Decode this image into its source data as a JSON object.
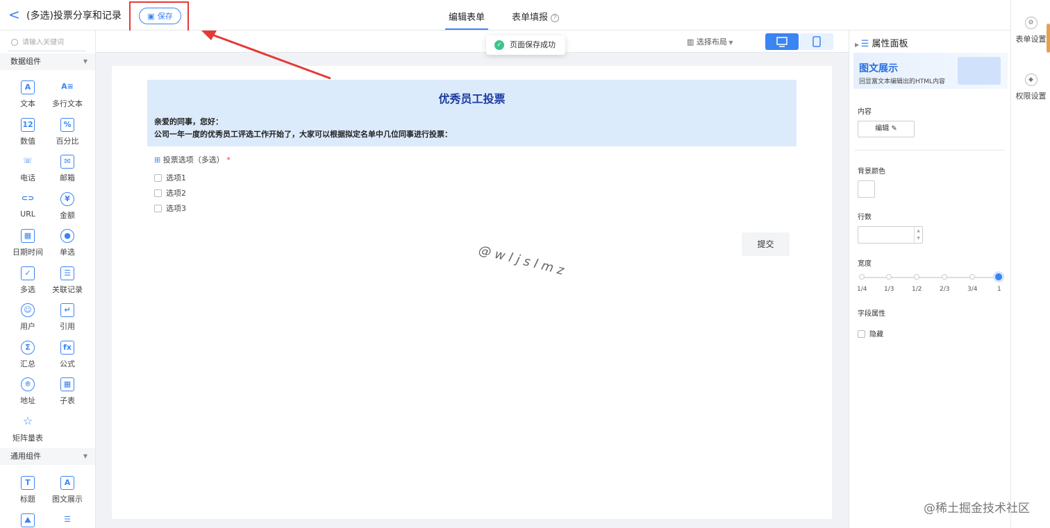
{
  "header": {
    "back": "<",
    "title": "(多选)投票分享和记录",
    "save_label": "保存",
    "tabs": [
      {
        "label": "编辑表单"
      },
      {
        "label": "表单填报"
      }
    ]
  },
  "toast": {
    "text": "页面保存成功"
  },
  "toolbar": {
    "layout_label": "选择布局"
  },
  "sidebar": {
    "search_placeholder": "请输入关键词",
    "groups": [
      {
        "label": "数据组件",
        "items": [
          "文本",
          "多行文本",
          "数值",
          "百分比",
          "电话",
          "邮箱",
          "URL",
          "金额",
          "日期时间",
          "单选",
          "多选",
          "关联记录",
          "用户",
          "引用",
          "汇总",
          "公式",
          "地址",
          "子表",
          "矩阵量表"
        ]
      },
      {
        "label": "通用组件",
        "items": [
          "标题",
          "图文展示"
        ]
      }
    ]
  },
  "form": {
    "heading": "优秀员工投票",
    "line1": "亲爱的同事，您好：",
    "line2": "公司一年一度的优秀员工评选工作开始了，大家可以根据拟定名单中几位同事进行投票：",
    "field_label": "投票选项（多选）",
    "options": [
      "选项1",
      "选项2",
      "选项3"
    ],
    "submit": "提交",
    "watermark": "@wljslmz"
  },
  "props": {
    "title": "属性面板",
    "banner_title": "图文展示",
    "banner_sub": "回显富文本编辑出的HTML内容",
    "content_label": "内容",
    "edit_label": "编辑",
    "bg_label": "背景颜色",
    "rows_label": "行数",
    "width_label": "宽度",
    "width_ticks": [
      "1/4",
      "1/3",
      "1/2",
      "2/3",
      "3/4",
      "1"
    ],
    "width_selected": "1",
    "field_attr_label": "字段属性",
    "hide_label": "隐藏"
  },
  "rail": {
    "items": [
      {
        "label": "表单设置"
      },
      {
        "label": "权限设置"
      }
    ]
  },
  "brand": "@稀土掘金技术社区",
  "colors": {
    "accent": "#3a84f4",
    "highlight": "#e53935",
    "banner": "#dcebfc"
  }
}
